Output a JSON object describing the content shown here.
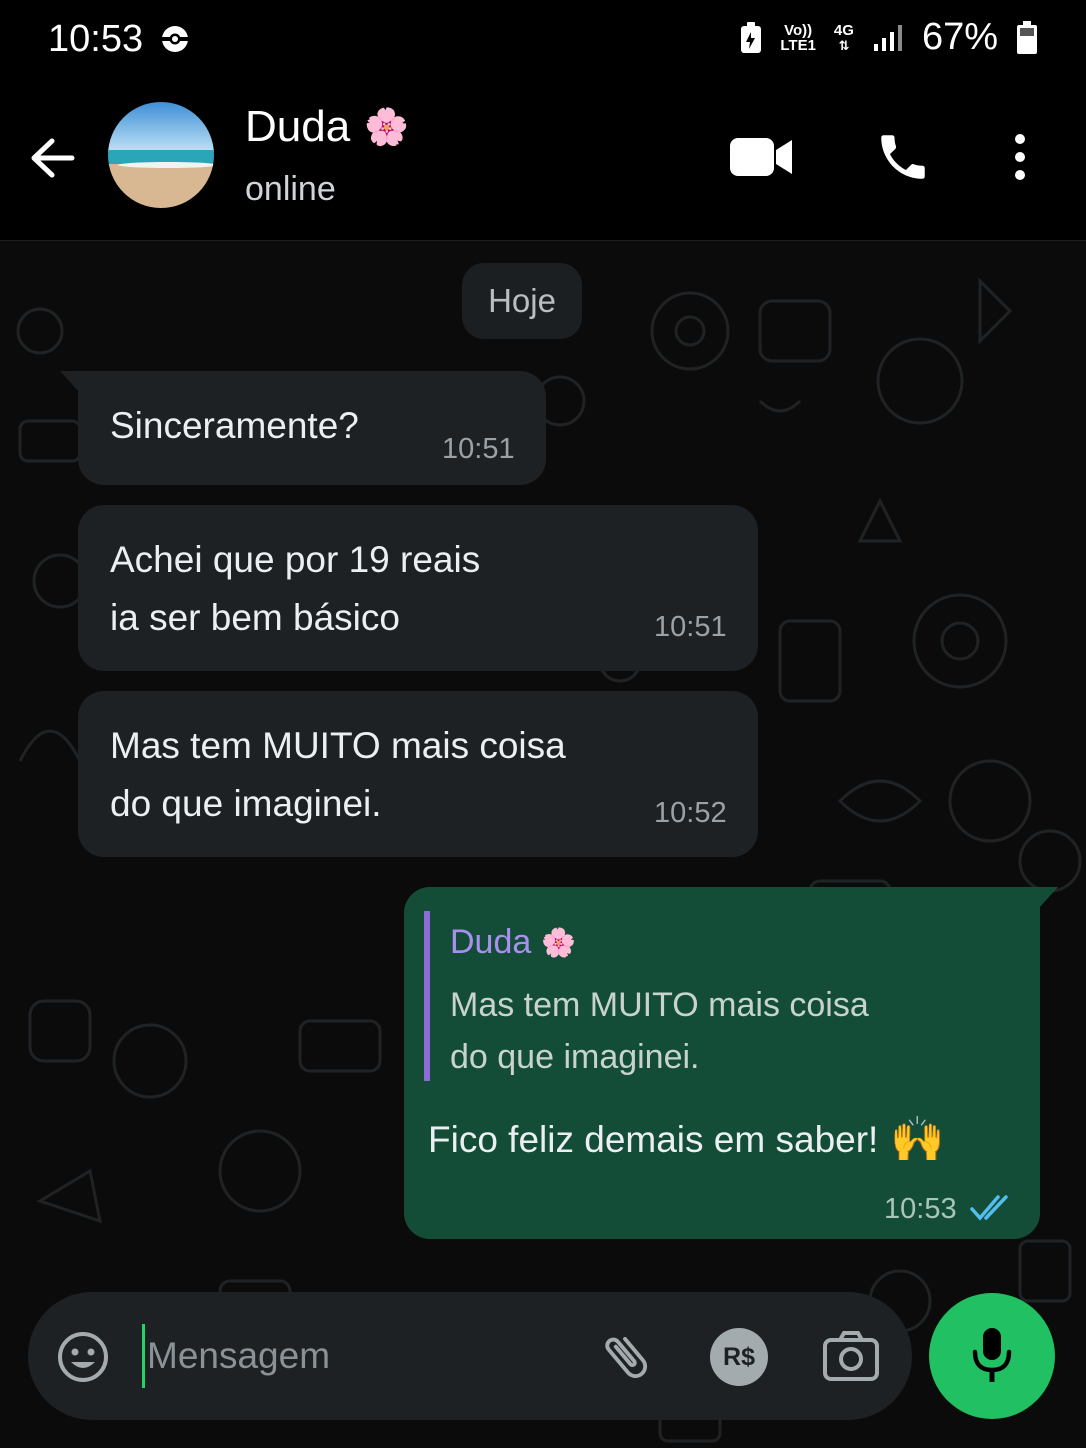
{
  "status_bar": {
    "time": "10:53",
    "network_top": "Vo))",
    "network_bottom": "LTE1",
    "network_type": "4G",
    "battery": "67%"
  },
  "header": {
    "contact_name": "Duda",
    "contact_emoji": "🌸",
    "status": "online"
  },
  "chat": {
    "day_label": "Hoje",
    "messages": [
      {
        "direction": "in",
        "lines": [
          "Sinceramente?"
        ],
        "time": "10:51"
      },
      {
        "direction": "in",
        "lines": [
          "Achei que por 19 reais",
          "ia ser bem básico"
        ],
        "time": "10:51"
      },
      {
        "direction": "in",
        "lines": [
          "Mas tem MUITO mais coisa",
          "do que imaginei."
        ],
        "time": "10:52"
      },
      {
        "direction": "out",
        "quote_author": "Duda",
        "quote_emoji": "🌸",
        "quote_lines": [
          "Mas tem MUITO mais coisa",
          "do que imaginei."
        ],
        "text": "Fico feliz demais em saber!",
        "text_emoji": "🙌",
        "time": "10:53",
        "read_status": "read"
      }
    ]
  },
  "composer": {
    "placeholder": "Mensagem",
    "currency_label": "R$"
  },
  "colors": {
    "accent_green": "#21c063",
    "outgoing_bubble": "#134d37",
    "incoming_bubble": "#1e2124",
    "read_tick": "#53bdeb",
    "quote_bar": "#8b6bd6"
  }
}
